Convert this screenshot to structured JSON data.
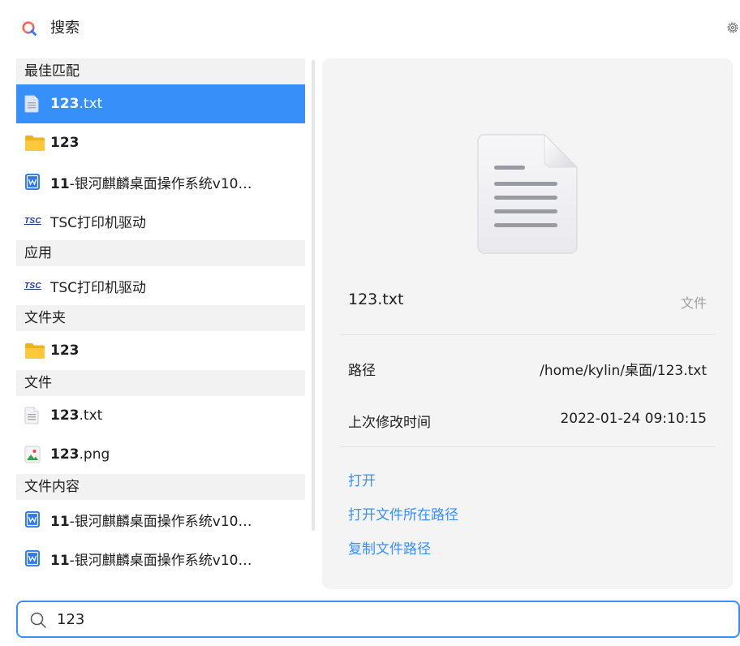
{
  "app": {
    "title": "搜索",
    "icon": "search-app-icon",
    "settings_icon": "gear-icon"
  },
  "results": {
    "sections": [
      {
        "title": "最佳匹配",
        "items": [
          {
            "match": "123",
            "rest": ".txt",
            "icon": "text-file-icon",
            "selected": true
          },
          {
            "match": "123",
            "rest": "",
            "icon": "folder-icon"
          },
          {
            "match": "11",
            "rest": "-银河麒麟桌面操作系统v10…",
            "icon": "document-icon"
          },
          {
            "match": "",
            "rest": "TSC打印机驱动",
            "icon": "tsc-logo-icon"
          }
        ]
      },
      {
        "title": "应用",
        "items": [
          {
            "match": "",
            "rest": "TSC打印机驱动",
            "icon": "tsc-logo-icon"
          }
        ]
      },
      {
        "title": "文件夹",
        "items": [
          {
            "match": "123",
            "rest": "",
            "icon": "folder-icon"
          }
        ]
      },
      {
        "title": "文件",
        "items": [
          {
            "match": "123",
            "rest": ".txt",
            "icon": "text-file-icon"
          },
          {
            "match": "123",
            "rest": ".png",
            "icon": "image-file-icon"
          }
        ]
      },
      {
        "title": "文件内容",
        "items": [
          {
            "match": "11",
            "rest": "-银河麒麟桌面操作系统v10…",
            "icon": "document-icon"
          },
          {
            "match": "11",
            "rest": "-银河麒麟桌面操作系统v10…",
            "icon": "document-icon"
          }
        ]
      }
    ],
    "tsc_logo_text": "TSC"
  },
  "detail": {
    "name": "123.txt",
    "type": "文件",
    "path_label": "路径",
    "path_value": "/home/kylin/桌面/123.txt",
    "modified_label": "上次修改时间",
    "modified_value": "2022-01-24 09:10:15",
    "actions": {
      "open": "打开",
      "open_location": "打开文件所在路径",
      "copy_path": "复制文件路径"
    }
  },
  "search": {
    "value": "123",
    "icon": "search-icon"
  },
  "colors": {
    "accent": "#3790fa",
    "section_bg": "#f2f2f2",
    "panel_bg": "#f4f4f5"
  }
}
